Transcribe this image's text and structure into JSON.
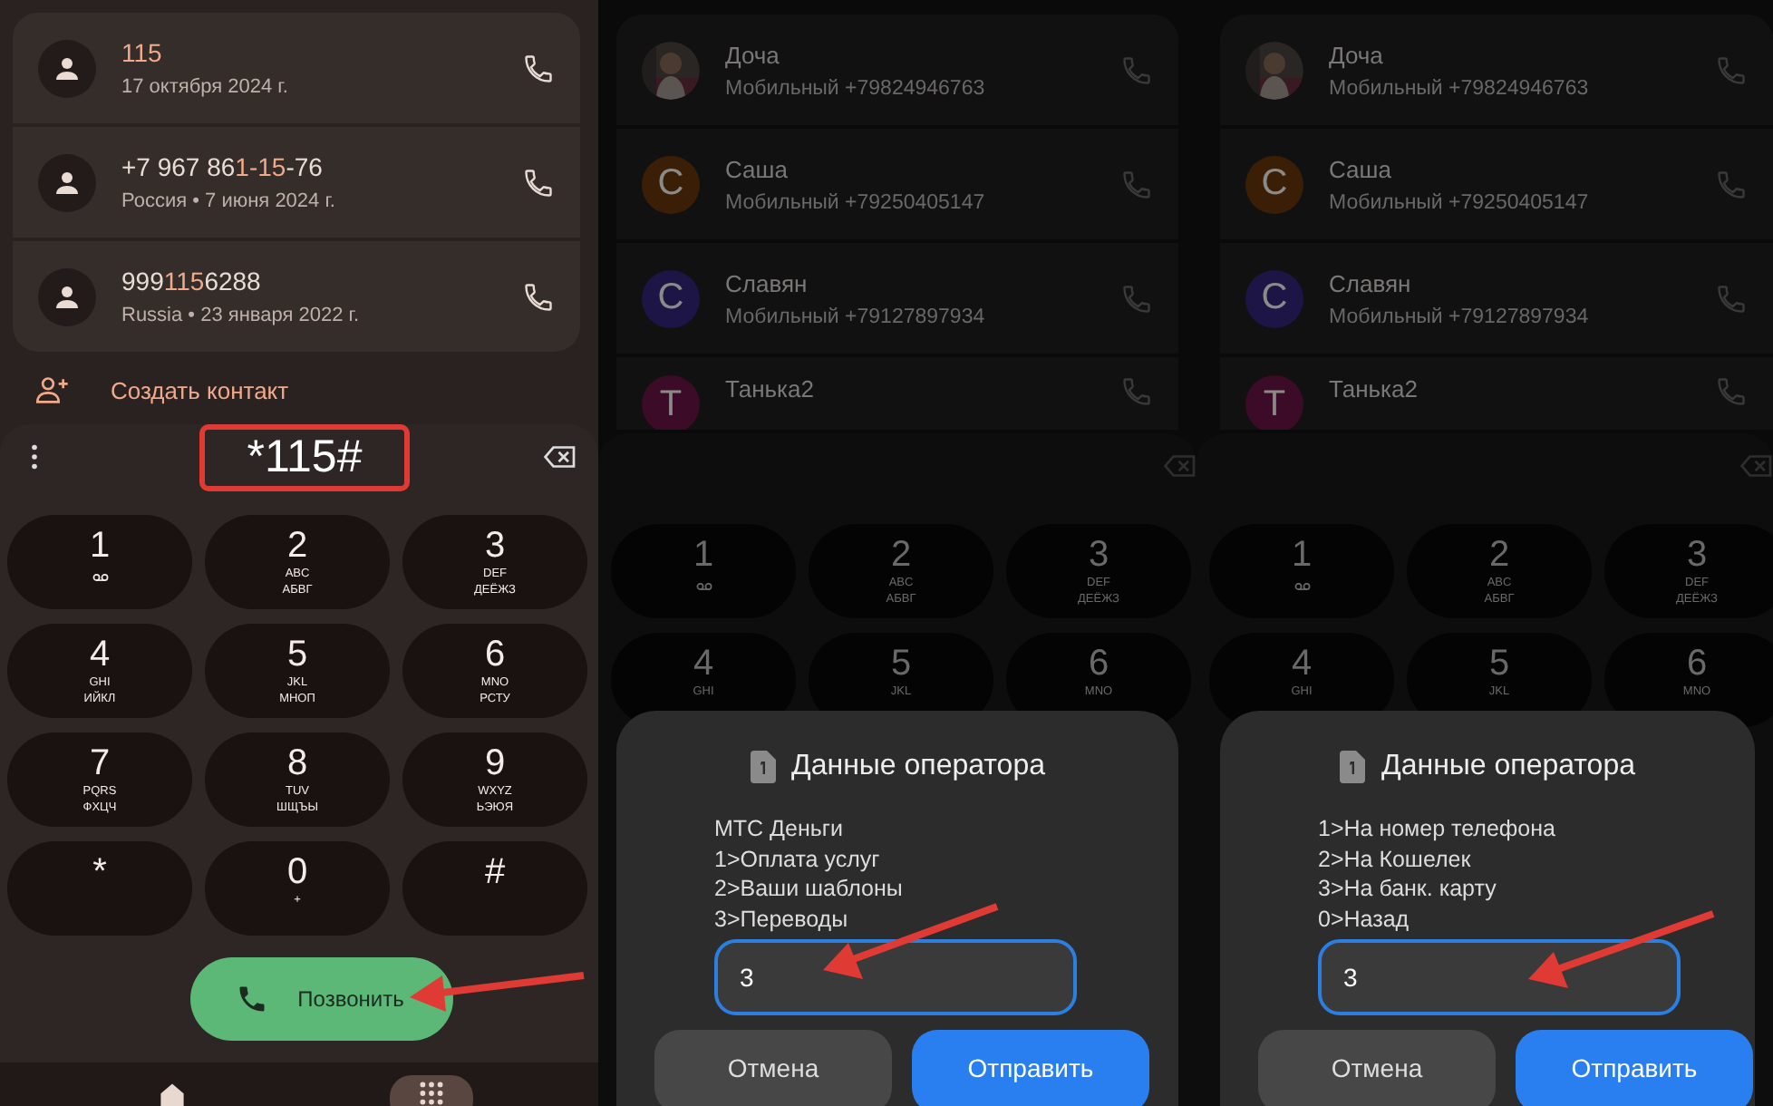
{
  "panels": [
    {
      "kind": "dialer",
      "recent_calls": [
        {
          "number": [
            {
              "text": "115",
              "match": true
            }
          ],
          "detail": "17 октября 2024 г."
        },
        {
          "number": [
            {
              "text": "+7 967 86",
              "match": false
            },
            {
              "text": "1-15",
              "match": true
            },
            {
              "text": "-76",
              "match": false
            }
          ],
          "detail": "Россия • 7 июня 2024 г."
        },
        {
          "number": [
            {
              "text": "999",
              "match": false
            },
            {
              "text": "115",
              "match": true
            },
            {
              "text": "6288",
              "match": false
            }
          ],
          "detail": "Russia • 23 января 2022 г."
        }
      ],
      "create_contact": "Создать контакт",
      "dialed": "*115#",
      "keys": [
        {
          "digit": "1",
          "voicemail": true
        },
        {
          "digit": "2",
          "voicemail": false,
          "letters": [
            "ABC",
            "АБВГ"
          ]
        },
        {
          "digit": "3",
          "voicemail": false,
          "letters": [
            "DEF",
            "ДЕЁЖЗ"
          ]
        },
        {
          "digit": "4",
          "voicemail": false,
          "letters": [
            "GHI",
            "ИЙКЛ"
          ]
        },
        {
          "digit": "5",
          "voicemail": false,
          "letters": [
            "JKL",
            "МНОП"
          ]
        },
        {
          "digit": "6",
          "voicemail": false,
          "letters": [
            "MNO",
            "РСТУ"
          ]
        },
        {
          "digit": "7",
          "voicemail": false,
          "letters": [
            "PQRS",
            "ФХЦЧ"
          ]
        },
        {
          "digit": "8",
          "voicemail": false,
          "letters": [
            "TUV",
            "ШЩЪЫ"
          ]
        },
        {
          "digit": "9",
          "voicemail": false,
          "letters": [
            "WXYZ",
            "ЬЭЮЯ"
          ]
        },
        {
          "digit": "*",
          "voicemail": false
        },
        {
          "digit": "0",
          "voicemail": false,
          "letters": [
            "+"
          ]
        },
        {
          "digit": "#",
          "voicemail": false
        }
      ],
      "call_button": "Позвонить",
      "nav": [
        {
          "kind": "home",
          "selected": false
        },
        {
          "kind": "dialpad",
          "selected": true
        }
      ]
    },
    {
      "kind": "ussd",
      "contacts": [
        {
          "name": "Доча",
          "detail": "Мобильный +79824946763"
        },
        {
          "kind": "letter",
          "letter": "С",
          "color": "#3a1f06",
          "name": "Саша",
          "detail": "Мобильный +79250405147"
        },
        {
          "kind": "letter",
          "letter": "С",
          "color": "#1d1545",
          "name": "Славян",
          "detail": "Мобильный +79127897934"
        },
        {
          "kind": "letter",
          "letter": "Т",
          "color": "#3c0b27",
          "name": "Танька2"
        }
      ],
      "keys": [
        {
          "digit": "1",
          "voicemail": true
        },
        {
          "digit": "2",
          "voicemail": false,
          "letters": [
            "ABC",
            "АБВГ"
          ]
        },
        {
          "digit": "3",
          "voicemail": false,
          "letters": [
            "DEF",
            "ДЕЁЖЗ"
          ]
        },
        {
          "digit": "4",
          "voicemail": false,
          "letters": [
            "GHI"
          ]
        },
        {
          "digit": "5",
          "voicemail": false,
          "letters": [
            "JKL"
          ]
        },
        {
          "digit": "6",
          "voicemail": false,
          "letters": [
            "MNO"
          ]
        }
      ],
      "dialog": {
        "title": "Данные оператора",
        "lines": [
          "МТС Деньги",
          "1>Оплата услуг",
          "2>Ваши шаблоны",
          "3>Переводы"
        ],
        "value": "3",
        "buttons": [
          "Отмена",
          "Отправить"
        ]
      }
    },
    {
      "kind": "ussd",
      "contacts": [
        {
          "name": "Доча",
          "detail": "Мобильный +79824946763"
        },
        {
          "kind": "letter",
          "letter": "С",
          "color": "#3a1f06",
          "name": "Саша",
          "detail": "Мобильный +79250405147"
        },
        {
          "kind": "letter",
          "letter": "С",
          "color": "#1d1545",
          "name": "Славян",
          "detail": "Мобильный +79127897934"
        },
        {
          "kind": "letter",
          "letter": "Т",
          "color": "#3c0b27",
          "name": "Танька2"
        }
      ],
      "keys": [
        {
          "digit": "1",
          "voicemail": true
        },
        {
          "digit": "2",
          "voicemail": false,
          "letters": [
            "ABC",
            "АБВГ"
          ]
        },
        {
          "digit": "3",
          "voicemail": false,
          "letters": [
            "DEF",
            "ДЕЁЖЗ"
          ]
        },
        {
          "digit": "4",
          "voicemail": false,
          "letters": [
            "GHI"
          ]
        },
        {
          "digit": "5",
          "voicemail": false,
          "letters": [
            "JKL"
          ]
        },
        {
          "digit": "6",
          "voicemail": false,
          "letters": [
            "MNO"
          ]
        }
      ],
      "dialog": {
        "title": "Данные оператора",
        "lines": [
          "1>На номер телефона",
          "2>На Кошелек",
          "3>На банк. карту",
          "0>Назад"
        ],
        "value": "3",
        "buttons": [
          "Отмена",
          "Отправить"
        ]
      }
    }
  ]
}
